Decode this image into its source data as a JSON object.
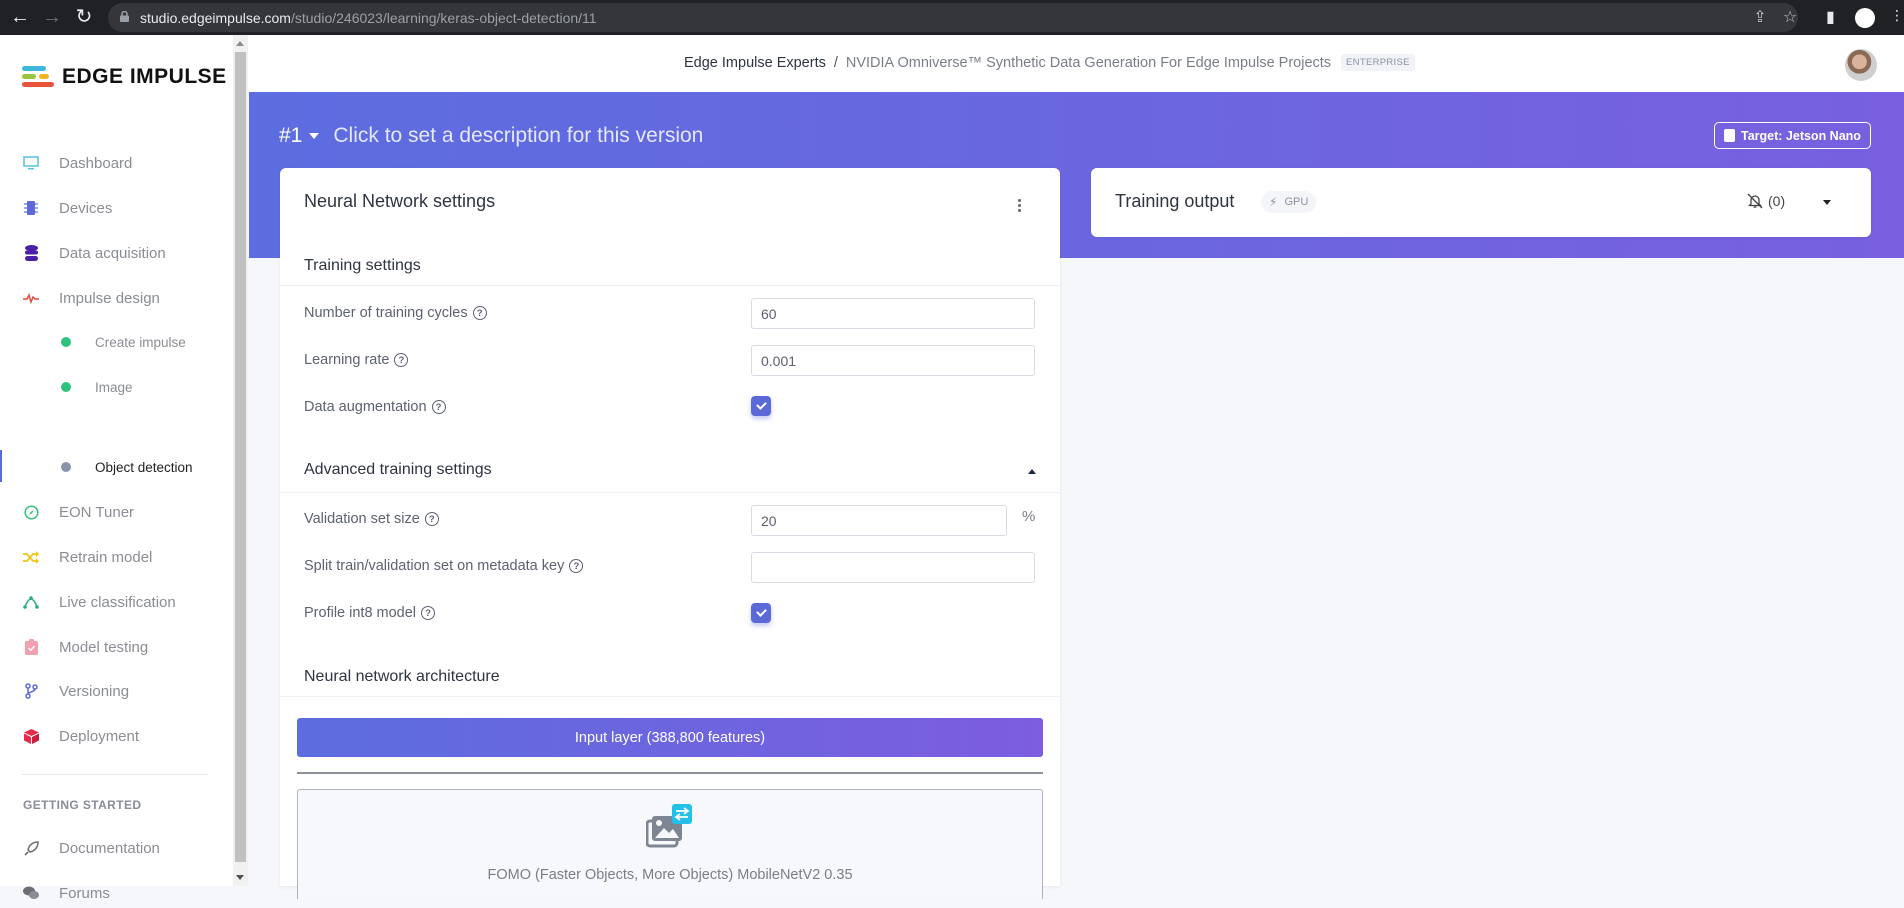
{
  "browser": {
    "url_host": "studio.edgeimpulse.com",
    "url_path": "/studio/246023/learning/keras-object-detection/11"
  },
  "sidebar": {
    "logo_text": "EDGE IMPULSE",
    "items": [
      {
        "label": "Dashboard",
        "icon": "monitor-icon",
        "color": "#5fc4e0"
      },
      {
        "label": "Devices",
        "icon": "chip-icon",
        "color": "#5b6ad8"
      },
      {
        "label": "Data acquisition",
        "icon": "database-icon",
        "color": "#4b1fa8"
      },
      {
        "label": "Impulse design",
        "icon": "pulse-icon",
        "color": "#e8493a"
      },
      {
        "label": "Create impulse",
        "sub": true,
        "dot_color": "#2ec27e"
      },
      {
        "label": "Image",
        "sub": true,
        "dot_color": "#2ec27e"
      },
      {
        "label": "Object detection",
        "sub": true,
        "dot_color": "#8a93a8",
        "active": true
      },
      {
        "label": "EON Tuner",
        "icon": "compass-icon",
        "color": "#3cbf7a"
      },
      {
        "label": "Retrain model",
        "icon": "shuffle-icon",
        "color": "#f2c418"
      },
      {
        "label": "Live classification",
        "icon": "bezier-icon",
        "color": "#28b07a"
      },
      {
        "label": "Model testing",
        "icon": "clipboard-check-icon",
        "color": "#f1a0b0"
      },
      {
        "label": "Versioning",
        "icon": "branch-icon",
        "color": "#5b6ad8"
      },
      {
        "label": "Deployment",
        "icon": "cube-icon",
        "color": "#e8294a"
      }
    ],
    "section_title": "GETTING STARTED",
    "getting_started": [
      {
        "label": "Documentation",
        "icon": "rocket-icon"
      },
      {
        "label": "Forums",
        "icon": "comments-icon"
      }
    ]
  },
  "header": {
    "org": "Edge Impulse Experts",
    "separator": "/",
    "project": "NVIDIA Omniverse™ Synthetic Data Generation For Edge Impulse Projects",
    "badge": "ENTERPRISE"
  },
  "banner": {
    "version": "#1",
    "description_placeholder": "Click to set a description for this version",
    "target_label": "Target: Jetson Nano"
  },
  "nn_settings": {
    "title": "Neural Network settings",
    "training_section": "Training settings",
    "fields": {
      "training_cycles": {
        "label": "Number of training cycles",
        "value": "60"
      },
      "learning_rate": {
        "label": "Learning rate",
        "value": "0.001"
      },
      "data_augmentation": {
        "label": "Data augmentation",
        "checked": true
      }
    },
    "advanced_section": "Advanced training settings",
    "advanced": {
      "validation_size": {
        "label": "Validation set size",
        "value": "20",
        "unit": "%"
      },
      "split_key": {
        "label": "Split train/validation set on metadata key",
        "value": ""
      },
      "profile_int8": {
        "label": "Profile int8 model",
        "checked": true
      }
    },
    "architecture_section": "Neural network architecture",
    "input_layer": "Input layer (388,800 features)",
    "model_block": "FOMO (Faster Objects, More Objects) MobileNetV2 0.35"
  },
  "training_output": {
    "title": "Training output",
    "badge": "GPU",
    "notifications": "(0)"
  },
  "colors": {
    "accent": "#5b6ad8",
    "banner_start": "#5c6de0",
    "banner_end": "#7860e0"
  }
}
